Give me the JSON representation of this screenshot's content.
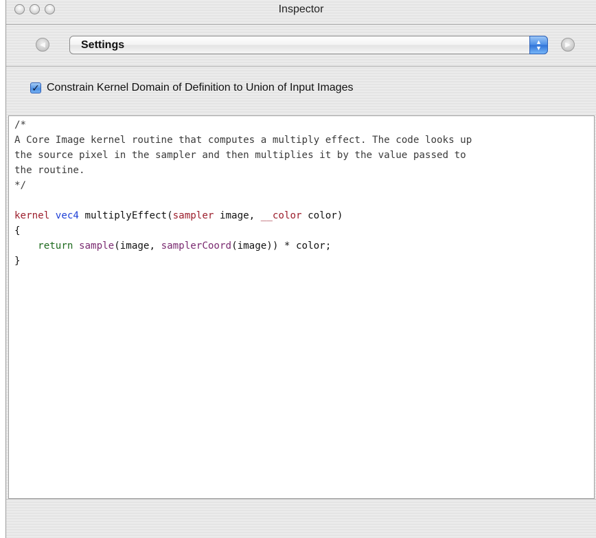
{
  "window": {
    "title": "Inspector"
  },
  "toolbar": {
    "popup_value": "Settings",
    "back_glyph": "◀",
    "forward_glyph": "▶"
  },
  "option": {
    "checked": true,
    "label": "Constrain Kernel Domain of Definition to Union of Input Images"
  },
  "editor": {
    "comment_open": "/*",
    "comment_line1": "A Core Image kernel routine that computes a multiply effect. The code looks up",
    "comment_line2": "the source pixel in the sampler and then multiplies it by the value passed to",
    "comment_line3": "the routine.",
    "comment_close": "*/",
    "sig": {
      "kw_kernel": "kernel",
      "kw_type": "vec4",
      "fn_name": " multiplyEffect(",
      "kw_sampler": "sampler",
      "arg1": " image, ",
      "kw_color": "__color",
      "arg2": " color)"
    },
    "brace_open": "{",
    "body": {
      "indent": "    ",
      "kw_return": "return",
      "sp": " ",
      "fn_sample": "sample",
      "p1": "(image, ",
      "fn_coord": "samplerCoord",
      "p2": "(image)) * color;"
    },
    "brace_close": "}"
  },
  "colors": {
    "keyword_red": "#9c1e2c",
    "type_blue": "#1d3fd6",
    "return_green": "#1d6a1d",
    "function_purple": "#7a2a70"
  }
}
